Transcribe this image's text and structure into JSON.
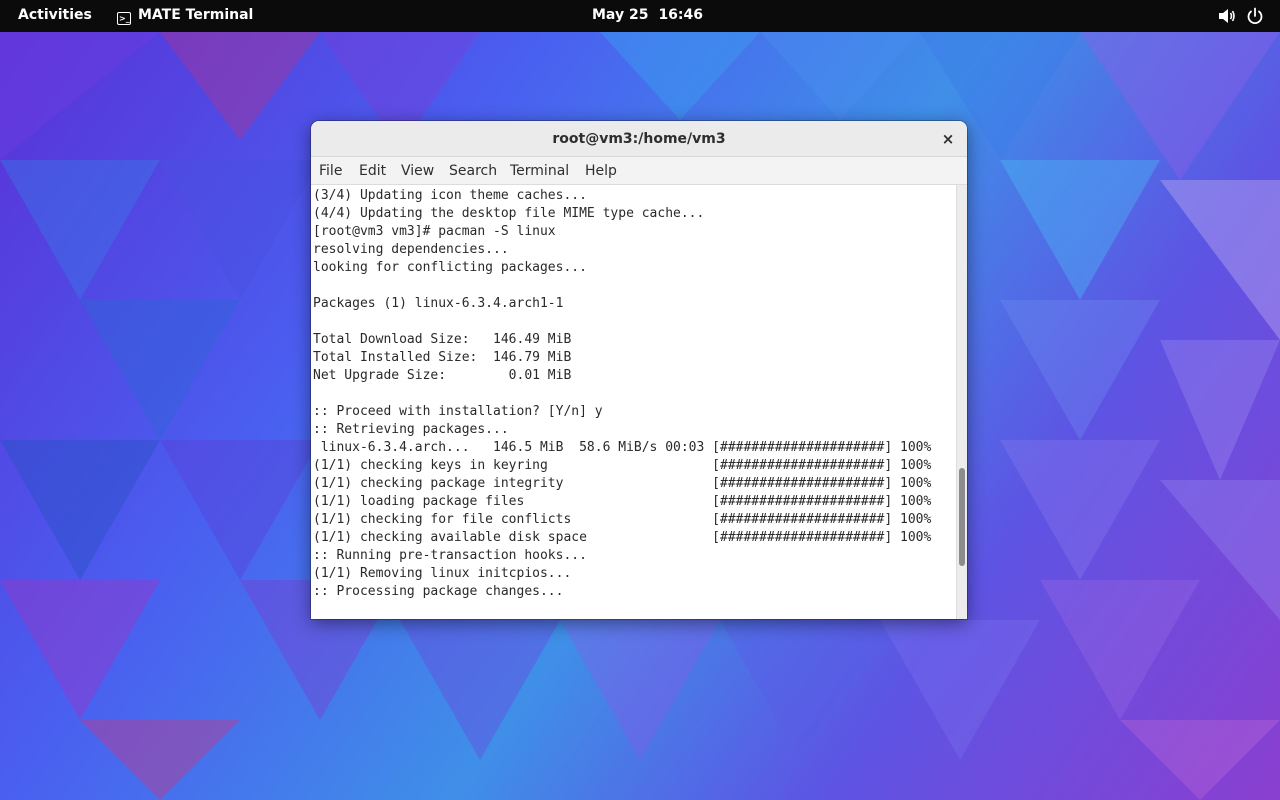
{
  "topbar": {
    "activities": "Activities",
    "app_name": "MATE Terminal",
    "app_icon_glyph": ">_",
    "date": "May 25",
    "time": "16:46",
    "icons": [
      "volume-icon",
      "power-icon"
    ]
  },
  "window": {
    "title": "root@vm3:/home/vm3",
    "close_glyph": "×",
    "menu": [
      "File",
      "Edit",
      "View",
      "Search",
      "Terminal",
      "Help"
    ]
  },
  "terminal": {
    "lines": [
      "(3/4) Updating icon theme caches...",
      "(4/4) Updating the desktop file MIME type cache...",
      "[root@vm3 vm3]# pacman -S linux",
      "resolving dependencies...",
      "looking for conflicting packages...",
      "",
      "Packages (1) linux-6.3.4.arch1-1",
      "",
      "Total Download Size:   146.49 MiB",
      "Total Installed Size:  146.79 MiB",
      "Net Upgrade Size:        0.01 MiB",
      "",
      ":: Proceed with installation? [Y/n] y",
      ":: Retrieving packages...",
      " linux-6.3.4.arch...   146.5 MiB  58.6 MiB/s 00:03 [#####################] 100%",
      "(1/1) checking keys in keyring                     [#####################] 100%",
      "(1/1) checking package integrity                   [#####################] 100%",
      "(1/1) loading package files                        [#####################] 100%",
      "(1/1) checking for file conflicts                  [#####################] 100%",
      "(1/1) checking available disk space                [#####################] 100%",
      ":: Running pre-transaction hooks...",
      "(1/1) Removing linux initcpios...",
      ":: Processing package changes..."
    ],
    "scroll_position": 0.85,
    "scroll_visible_fraction": 0.23
  },
  "colors": {
    "topbar_bg": "#0b0b0b",
    "terminal_bg": "#ffffff",
    "terminal_fg": "#2a2a2a",
    "titlebar_bg": "#ebebeb"
  }
}
